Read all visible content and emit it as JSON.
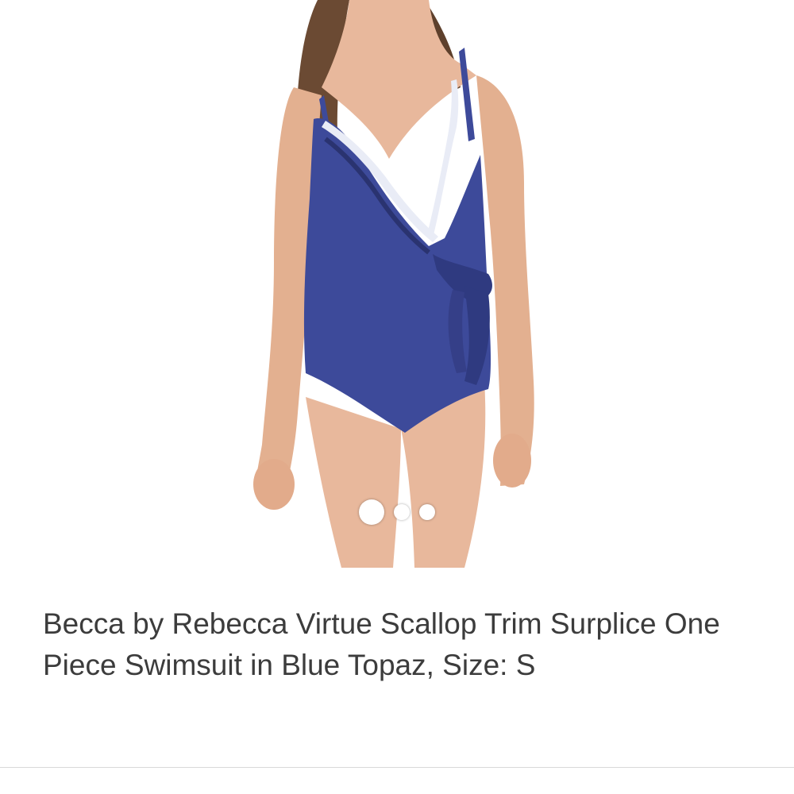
{
  "product": {
    "title": "Becca by Rebecca Virtue Scallop Trim Surplice One Piece Swimsuit in Blue Topaz, Size: S",
    "image_alt": "Blue Topaz one piece swimsuit with scallop trim and side tie"
  },
  "carousel": {
    "total_images": 3,
    "active_index": 0,
    "dots": [
      {
        "label": "Image 1",
        "active": true
      },
      {
        "label": "Image 2",
        "active": false
      },
      {
        "label": "Image 3",
        "active": false
      }
    ]
  },
  "colors": {
    "swimsuit": "#3d4a9a",
    "swimsuit_shadow": "#2f3a80",
    "trim": "#e9ecf6",
    "skin": "#e8b89c",
    "hair": "#6b4a33",
    "title_text": "#3c3c3c",
    "divider": "#d9d9d9"
  }
}
